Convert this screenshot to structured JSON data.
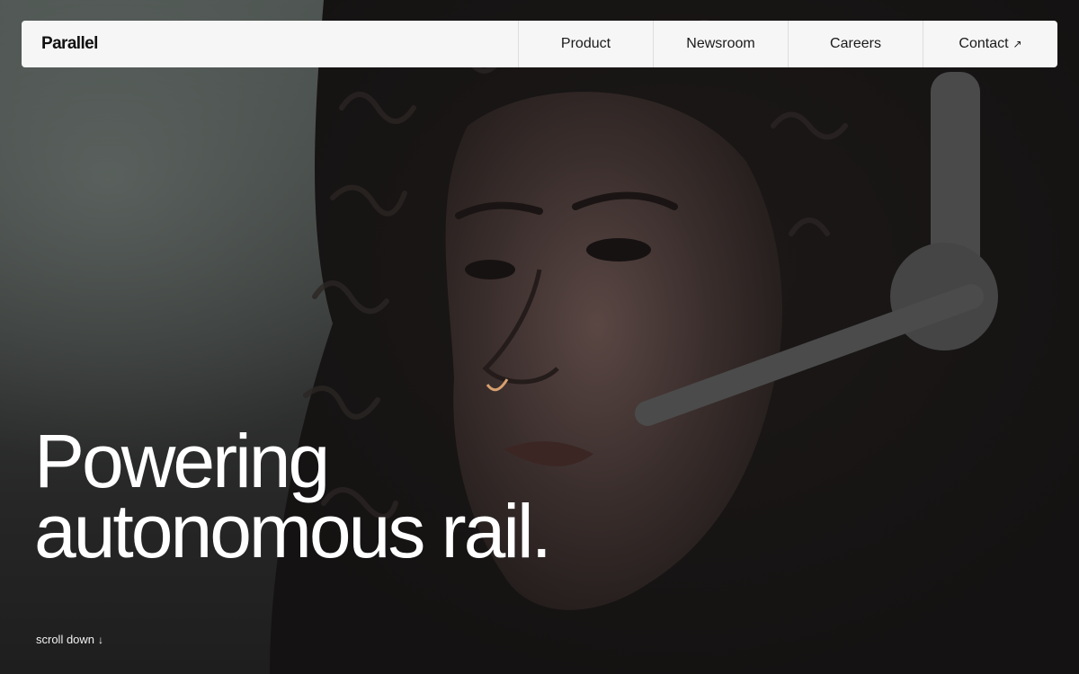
{
  "brand": {
    "logo_text": "Parallel"
  },
  "nav": {
    "items": [
      {
        "label": "Product"
      },
      {
        "label": "Newsroom"
      },
      {
        "label": "Careers"
      },
      {
        "label": "Contact",
        "icon": "arrow-up-right-icon",
        "arrow_glyph": "↗"
      }
    ]
  },
  "hero": {
    "headline_line1": "Powering",
    "headline_line2": "autonomous rail.",
    "image": "background-video-person-with-headset"
  },
  "scroll": {
    "label": "scroll down",
    "icon": "arrow-down-icon",
    "arrow_glyph": "↓"
  },
  "colors": {
    "nav_bg": "#f6f6f6",
    "text_light": "#ffffff",
    "text_dark": "#111111"
  }
}
